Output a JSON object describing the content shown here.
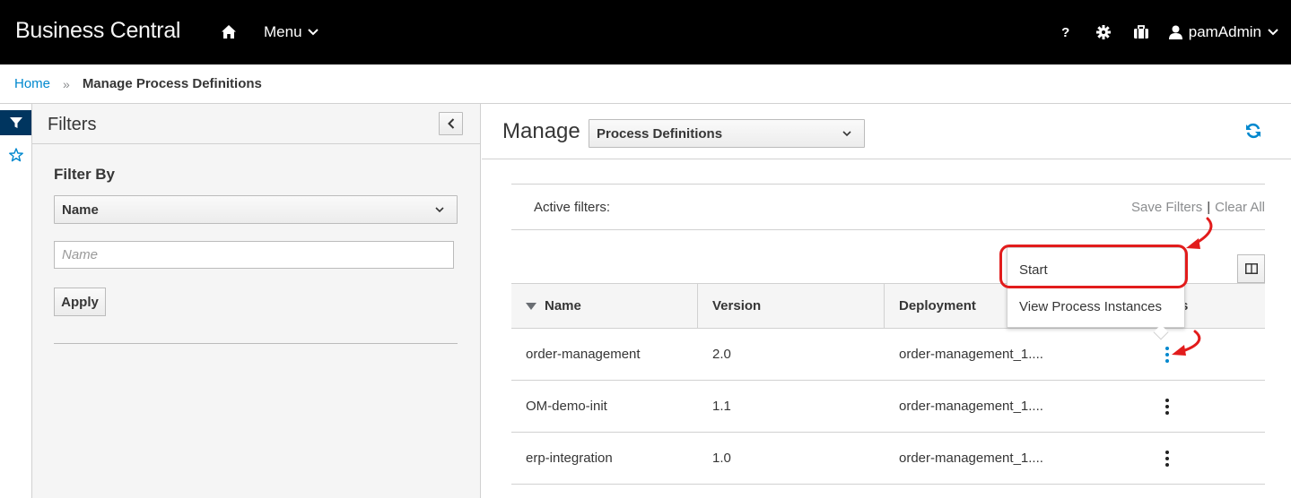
{
  "navbar": {
    "brand": "Business Central",
    "menu_label": "Menu",
    "help_label": "?",
    "user_name": "pamAdmin"
  },
  "breadcrumb": {
    "home": "Home",
    "separator": "»",
    "current": "Manage Process Definitions"
  },
  "filters": {
    "title": "Filters",
    "filter_by_label": "Filter By",
    "filter_select_value": "Name",
    "name_placeholder": "Name",
    "apply_label": "Apply"
  },
  "main": {
    "manage_label": "Manage",
    "view_select_value": "Process Definitions",
    "active_filters_label": "Active filters:",
    "save_filters_label": "Save Filters",
    "pipe": "|",
    "clear_all_label": "Clear All",
    "columns": [
      "Name",
      "Version",
      "Deployment",
      "Actions"
    ],
    "rows": [
      {
        "name": "order-management",
        "version": "2.0",
        "deployment": "order-management_1...."
      },
      {
        "name": "OM-demo-init",
        "version": "1.1",
        "deployment": "order-management_1...."
      },
      {
        "name": "erp-integration",
        "version": "1.0",
        "deployment": "order-management_1...."
      }
    ],
    "dropdown": {
      "start_label": "Start",
      "view_instances_label": "View Process Instances"
    },
    "header_actions_visible_fragment": "s"
  },
  "colors": {
    "navbar_bg": "#000000",
    "link_blue": "#0088ce",
    "vtab_active_bg": "#00355f",
    "annotation_red": "#e21c1c"
  }
}
